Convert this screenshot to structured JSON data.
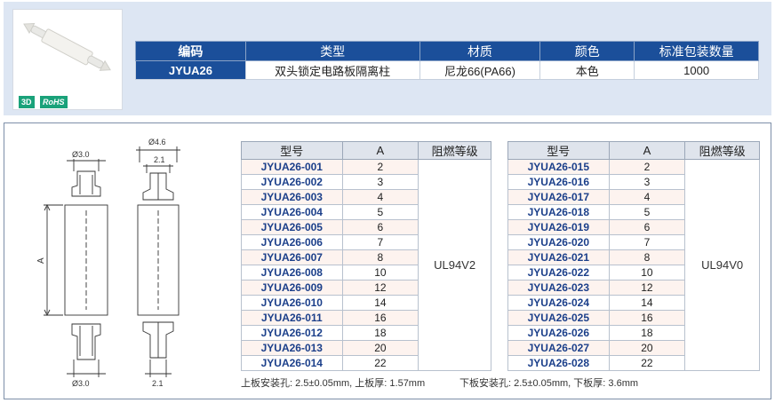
{
  "badges": {
    "three_d": "3D",
    "rohs": "RoHS"
  },
  "spec": {
    "headers": [
      "编码",
      "类型",
      "材质",
      "颜色",
      "标准包装数量"
    ],
    "row": [
      "JYUA26",
      "双头锁定电路板隔离柱",
      "尼龙66(PA66)",
      "本色",
      "1000"
    ]
  },
  "drawing": {
    "dim_top_left": "Ø3.0",
    "dim_top_right_outer": "Ø4.6",
    "dim_top_right_inner": "2.1",
    "dim_bottom_left": "Ø3.0",
    "dim_bottom_right": "2.1",
    "dim_side": "A"
  },
  "table_left": {
    "headers": [
      "型号",
      "A",
      "阻燃等级"
    ],
    "rating": "UL94V2",
    "rows": [
      [
        "JYUA26-001",
        "2"
      ],
      [
        "JYUA26-002",
        "3"
      ],
      [
        "JYUA26-003",
        "4"
      ],
      [
        "JYUA26-004",
        "5"
      ],
      [
        "JYUA26-005",
        "6"
      ],
      [
        "JYUA26-006",
        "7"
      ],
      [
        "JYUA26-007",
        "8"
      ],
      [
        "JYUA26-008",
        "10"
      ],
      [
        "JYUA26-009",
        "12"
      ],
      [
        "JYUA26-010",
        "14"
      ],
      [
        "JYUA26-011",
        "16"
      ],
      [
        "JYUA26-012",
        "18"
      ],
      [
        "JYUA26-013",
        "20"
      ],
      [
        "JYUA26-014",
        "22"
      ]
    ]
  },
  "table_right": {
    "headers": [
      "型号",
      "A",
      "阻燃等级"
    ],
    "rating": "UL94V0",
    "rows": [
      [
        "JYUA26-015",
        "2"
      ],
      [
        "JYUA26-016",
        "3"
      ],
      [
        "JYUA26-017",
        "4"
      ],
      [
        "JYUA26-018",
        "5"
      ],
      [
        "JYUA26-019",
        "6"
      ],
      [
        "JYUA26-020",
        "7"
      ],
      [
        "JYUA26-021",
        "8"
      ],
      [
        "JYUA26-022",
        "10"
      ],
      [
        "JYUA26-023",
        "12"
      ],
      [
        "JYUA26-024",
        "14"
      ],
      [
        "JYUA26-025",
        "16"
      ],
      [
        "JYUA26-026",
        "18"
      ],
      [
        "JYUA26-027",
        "20"
      ],
      [
        "JYUA26-028",
        "22"
      ]
    ]
  },
  "notes": {
    "upper": "上板安装孔: 2.5±0.05mm, 上板厚: 1.57mm",
    "lower": "下板安装孔: 2.5±0.05mm, 下板厚: 3.6mm"
  },
  "colors": {
    "header_blue": "#1b4f9a",
    "accent_green": "#1aa27a",
    "panel_bg": "#dde6f3"
  }
}
